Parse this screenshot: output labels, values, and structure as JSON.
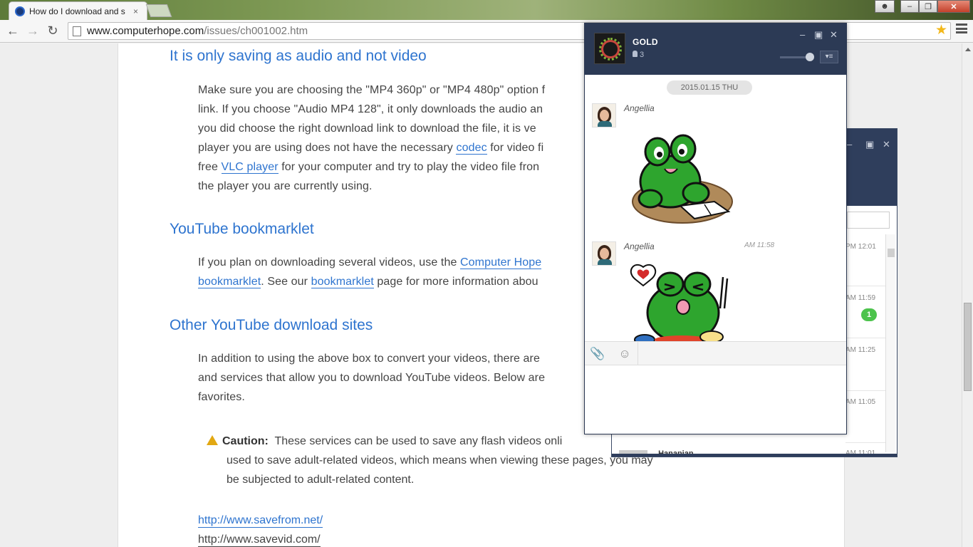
{
  "browser": {
    "tab_title": "How do I download and s",
    "tab_close": "×",
    "url_host": "www.computerhope.com",
    "url_path": "/issues/ch001002.htm",
    "window_buttons": {
      "minimize": "–",
      "maximize": "❐",
      "close": "✕"
    }
  },
  "article": {
    "h_audio": "It is only saving as audio and not video",
    "p_audio_1": "Make sure you are choosing the \"MP4 360p\" or \"MP4 480p\" option f",
    "p_audio_2": "link. If you choose \"Audio MP4 128\", it only downloads the audio an",
    "p_audio_3": "you did choose the right download link to download the file, it is ve",
    "p_audio_4a": "player you are using does not have the necessary ",
    "p_audio_4_link": "codec",
    "p_audio_4b": " for video fi",
    "p_audio_5a": "free ",
    "p_audio_5_link": "VLC player",
    "p_audio_5b": " for your computer and try to play the video file fron",
    "p_audio_6": "the player you are currently using.",
    "h_bookmarklet": "YouTube bookmarklet",
    "p_book_1a": "If you plan on downloading several videos, use the ",
    "p_book_1_link": "Computer Hope",
    "p_book_2_link": "bookmarklet",
    "p_book_2b": ". See our ",
    "p_book_2_link2": "bookmarklet",
    "p_book_2c": " page for more information abou",
    "h_other": "Other YouTube download sites",
    "p_other_1": "In addition to using the above box to convert your videos, there are",
    "p_other_2": "and services that allow you to download YouTube videos. Below are",
    "p_other_3": "favorites.",
    "caution_label": "Caution:",
    "caution_1": "These services can be used to save any flash videos onli",
    "caution_2": "used to save adult-related videos, which means when viewing these pages, you may",
    "caution_3": "be subjected to adult-related content.",
    "links": [
      "http://www.savefrom.net/",
      "http://www.savevid.com/"
    ]
  },
  "back_chat": {
    "times": [
      "PM 12:01",
      "AM 11:59",
      "AM 11:25",
      "AM 11:05",
      "AM 11:01"
    ],
    "unread": "1",
    "partial_name": "Hananian"
  },
  "chat": {
    "group_name": "GOLD",
    "member_count": "3",
    "date": "2015.01.15 THU",
    "messages": [
      {
        "sender": "Angellia",
        "time": "AM 11:58"
      },
      {
        "sender": "Angellia",
        "time": ""
      }
    ],
    "attach_icon": "📎",
    "emoji_icon": "☺",
    "menu_icon": "▾≡"
  },
  "colors": {
    "link": "#2e74cf",
    "chat_header": "#2c3a55",
    "unread_badge": "#4cc34c",
    "frog_green": "#2ea52e"
  }
}
